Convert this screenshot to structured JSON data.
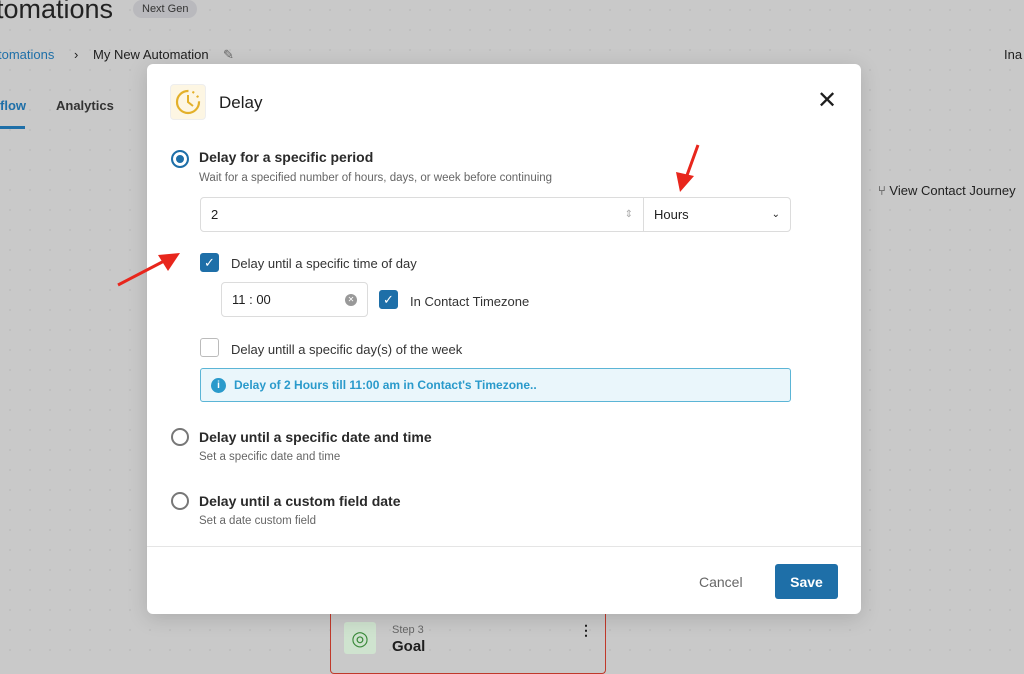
{
  "page": {
    "title": "tomations",
    "badge": "Next Gen",
    "breadcrumb": {
      "parent": "tomations",
      "current": "My New Automation"
    },
    "tabs": [
      "flow",
      "Analytics"
    ],
    "view_journey": "View Contact Journey",
    "user": "Ina",
    "step_card": {
      "step": "Step 3",
      "name": "Goal"
    }
  },
  "modal": {
    "title": "Delay",
    "close": "✕",
    "option1": {
      "label": "Delay for a specific period",
      "desc": "Wait for a specified number of hours, days, or week before continuing",
      "value": "2",
      "unit": "Hours"
    },
    "time_of_day": {
      "label": "Delay until a specific time of day",
      "checked": true,
      "time": "11 : 00",
      "tz_label": "In Contact Timezone",
      "tz_checked": true
    },
    "days_of_week": {
      "label": "Delay untill a specific day(s) of the week",
      "checked": false
    },
    "info": "Delay of 2 Hours till 11:00 am in Contact's Timezone..",
    "option2": {
      "label": "Delay until a specific date and time",
      "desc": "Set a specific date and time"
    },
    "option3": {
      "label": "Delay until a custom field date",
      "desc": "Set a date custom field"
    },
    "selected_option": 1,
    "cancel": "Cancel",
    "save": "Save"
  },
  "colors": {
    "accent": "#1e6fa8",
    "annotation_arrow": "#e8261c",
    "info": "#2a9acb"
  }
}
